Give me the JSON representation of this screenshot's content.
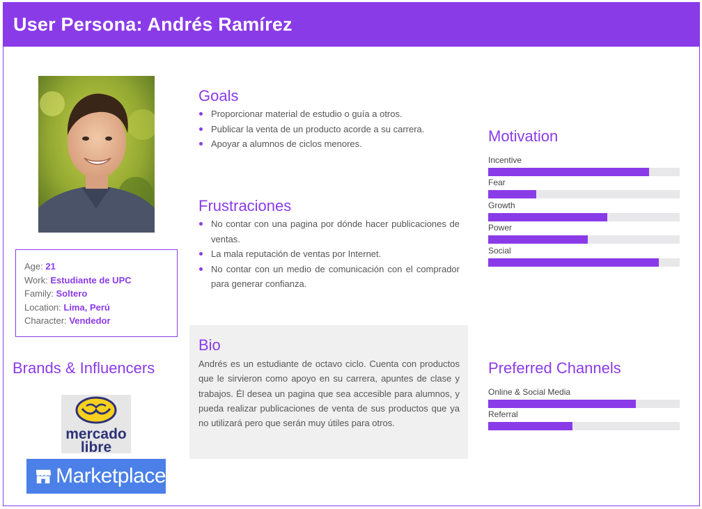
{
  "header": {
    "title": "User Persona: Andrés Ramírez"
  },
  "profile": {
    "photo_icon": "person-photo",
    "fields": [
      {
        "label": "Age: ",
        "value": "21"
      },
      {
        "label": "Work: ",
        "value": "Estudiante de UPC"
      },
      {
        "label": "Family: ",
        "value": "Soltero"
      },
      {
        "label": "Location: ",
        "value": "Lima, Perú"
      },
      {
        "label": "Character: ",
        "value": "Vendedor"
      }
    ]
  },
  "brands": {
    "title": "Brands & Influencers",
    "items": [
      {
        "name": "mercado libre",
        "line1": "mercado",
        "line2": "libre"
      },
      {
        "name": "Marketplace",
        "text": "Marketplace"
      }
    ]
  },
  "goals": {
    "title": "Goals",
    "items": [
      "Proporcionar material de estudio o guía a otros.",
      "Publicar la venta de un producto acorde a su carrera.",
      "Apoyar a alumnos de ciclos menores."
    ]
  },
  "frustrations": {
    "title": "Frustraciones",
    "items": [
      "No contar con una pagina por dónde hacer publicaciones de ventas.",
      "La mala reputación de ventas por Internet.",
      "No contar con un medio de comunicación con el comprador para generar confianza."
    ]
  },
  "bio": {
    "title": "Bio",
    "text": "Andrés es un estudiante de octavo ciclo. Cuenta con productos que le sirvieron como apoyo en su carrera, apuntes de clase y trabajos. Él desea un pagina que sea accesible para alumnos, y pueda realizar publicaciones de venta de sus productos que ya no utilizará pero que serán muy útiles para otros."
  },
  "motivation": {
    "title": "Motivation",
    "items": [
      {
        "label": "Incentive",
        "level": 0.84
      },
      {
        "label": "Fear",
        "level": 0.25
      },
      {
        "label": "Growth",
        "level": 0.62
      },
      {
        "label": "Power",
        "level": 0.52
      },
      {
        "label": "Social",
        "level": 0.89
      }
    ]
  },
  "channels": {
    "title": "Preferred Channels",
    "items": [
      {
        "label": "Online & Social Media",
        "level": 0.77
      },
      {
        "label": "Referral",
        "level": 0.44
      }
    ]
  },
  "colors": {
    "accent": "#8a3be8",
    "track": "#e8e8ea",
    "bio_bg": "#f0f0f0",
    "marketplace_blue": "#4a80e7"
  }
}
